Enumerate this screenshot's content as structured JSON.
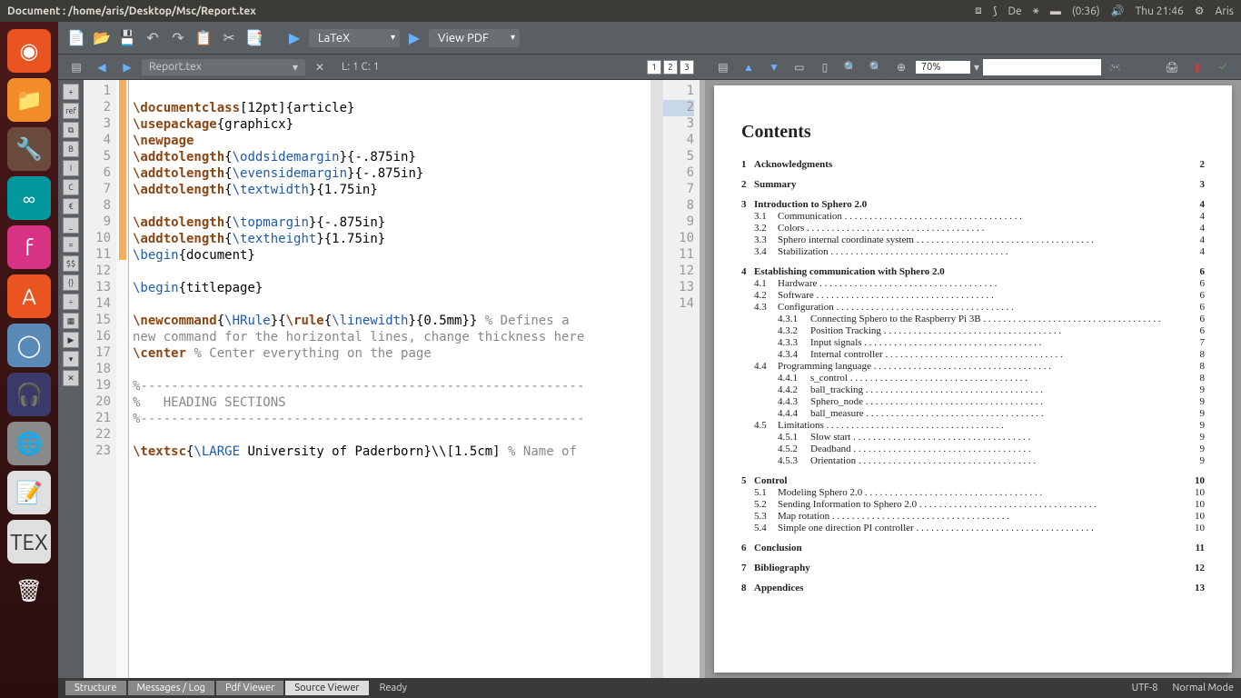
{
  "topbar": {
    "title": "Document : /home/aris/Desktop/Msc/Report.tex",
    "keyboard": "De",
    "battery": "(0:36)",
    "time": "Thu 21:46",
    "user": "Aris"
  },
  "toolbar": {
    "build_dropdown": "LaTeX",
    "view_dropdown": "View PDF"
  },
  "tab": {
    "filename": "Report.tex",
    "cursor": "L: 1 C: 1",
    "zoom": "70%"
  },
  "editor_lines": [
    "1",
    "2",
    "3",
    "4",
    "5",
    "6",
    "7",
    "8",
    "9",
    "10",
    "11",
    "12",
    "13",
    "14",
    "15",
    "16",
    "17",
    "18",
    "19",
    "20",
    "21",
    "22",
    "23"
  ],
  "minimap_lines": [
    "1",
    "2",
    "3",
    "4",
    "5",
    "6",
    "7",
    "8",
    "9",
    "10",
    "11",
    "12",
    "13",
    "14"
  ],
  "pdf": {
    "heading": "Contents",
    "toc": [
      {
        "n": "1",
        "l": "Acknowledgments",
        "p": "2",
        "subs": []
      },
      {
        "n": "2",
        "l": "Summary",
        "p": "3",
        "subs": []
      },
      {
        "n": "3",
        "l": "Introduction to Sphero 2.0",
        "p": "4",
        "subs": [
          {
            "n": "3.1",
            "l": "Communication",
            "p": "4"
          },
          {
            "n": "3.2",
            "l": "Colors",
            "p": "4"
          },
          {
            "n": "3.3",
            "l": "Sphero internal coordinate system",
            "p": "4"
          },
          {
            "n": "3.4",
            "l": "Stabilization",
            "p": "4"
          }
        ]
      },
      {
        "n": "4",
        "l": "Establishing communication with Sphero 2.0",
        "p": "6",
        "subs": [
          {
            "n": "4.1",
            "l": "Hardware",
            "p": "6"
          },
          {
            "n": "4.2",
            "l": "Software",
            "p": "6"
          },
          {
            "n": "4.3",
            "l": "Configuration",
            "p": "6",
            "subsubs": [
              {
                "n": "4.3.1",
                "l": "Connecting Sphero to the Raspberry Pi 3B",
                "p": "6"
              },
              {
                "n": "4.3.2",
                "l": "Position Tracking",
                "p": "6"
              },
              {
                "n": "4.3.3",
                "l": "Input signals",
                "p": "7"
              },
              {
                "n": "4.3.4",
                "l": "Internal controller",
                "p": "8"
              }
            ]
          },
          {
            "n": "4.4",
            "l": "Programming language",
            "p": "8",
            "subsubs": [
              {
                "n": "4.4.1",
                "l": "s_control",
                "p": "8"
              },
              {
                "n": "4.4.2",
                "l": "ball_tracking",
                "p": "9"
              },
              {
                "n": "4.4.3",
                "l": "Sphero_node",
                "p": "9"
              },
              {
                "n": "4.4.4",
                "l": "ball_measure",
                "p": "9"
              }
            ]
          },
          {
            "n": "4.5",
            "l": "Limitations",
            "p": "9",
            "subsubs": [
              {
                "n": "4.5.1",
                "l": "Slow start",
                "p": "9"
              },
              {
                "n": "4.5.2",
                "l": "Deadband",
                "p": "9"
              },
              {
                "n": "4.5.3",
                "l": "Orientation",
                "p": "9"
              }
            ]
          }
        ]
      },
      {
        "n": "5",
        "l": "Control",
        "p": "10",
        "subs": [
          {
            "n": "5.1",
            "l": "Modeling Sphero 2.0",
            "p": "10"
          },
          {
            "n": "5.2",
            "l": "Sending Information to Sphero 2.0",
            "p": "10"
          },
          {
            "n": "5.3",
            "l": "Map rotation",
            "p": "10"
          },
          {
            "n": "5.4",
            "l": "Simple one direction PI controller",
            "p": "10"
          }
        ]
      },
      {
        "n": "6",
        "l": "Conclusion",
        "p": "11",
        "subs": []
      },
      {
        "n": "7",
        "l": "Bibliography",
        "p": "12",
        "subs": []
      },
      {
        "n": "8",
        "l": "Appendices",
        "p": "13",
        "subs": []
      }
    ]
  },
  "status": {
    "tab1": "Structure",
    "tab2": "Messages / Log",
    "tab3": "Pdf Viewer",
    "tab4": "Source Viewer",
    "msg": "Ready",
    "encoding": "UTF-8",
    "mode": "Normal Mode"
  },
  "side_tool_labels": [
    "+",
    "ref",
    "⧉",
    "B",
    "I",
    "C",
    "€",
    "_",
    "=",
    "$$",
    "{}",
    "÷",
    "▦",
    "▶",
    "▾",
    "✕"
  ]
}
